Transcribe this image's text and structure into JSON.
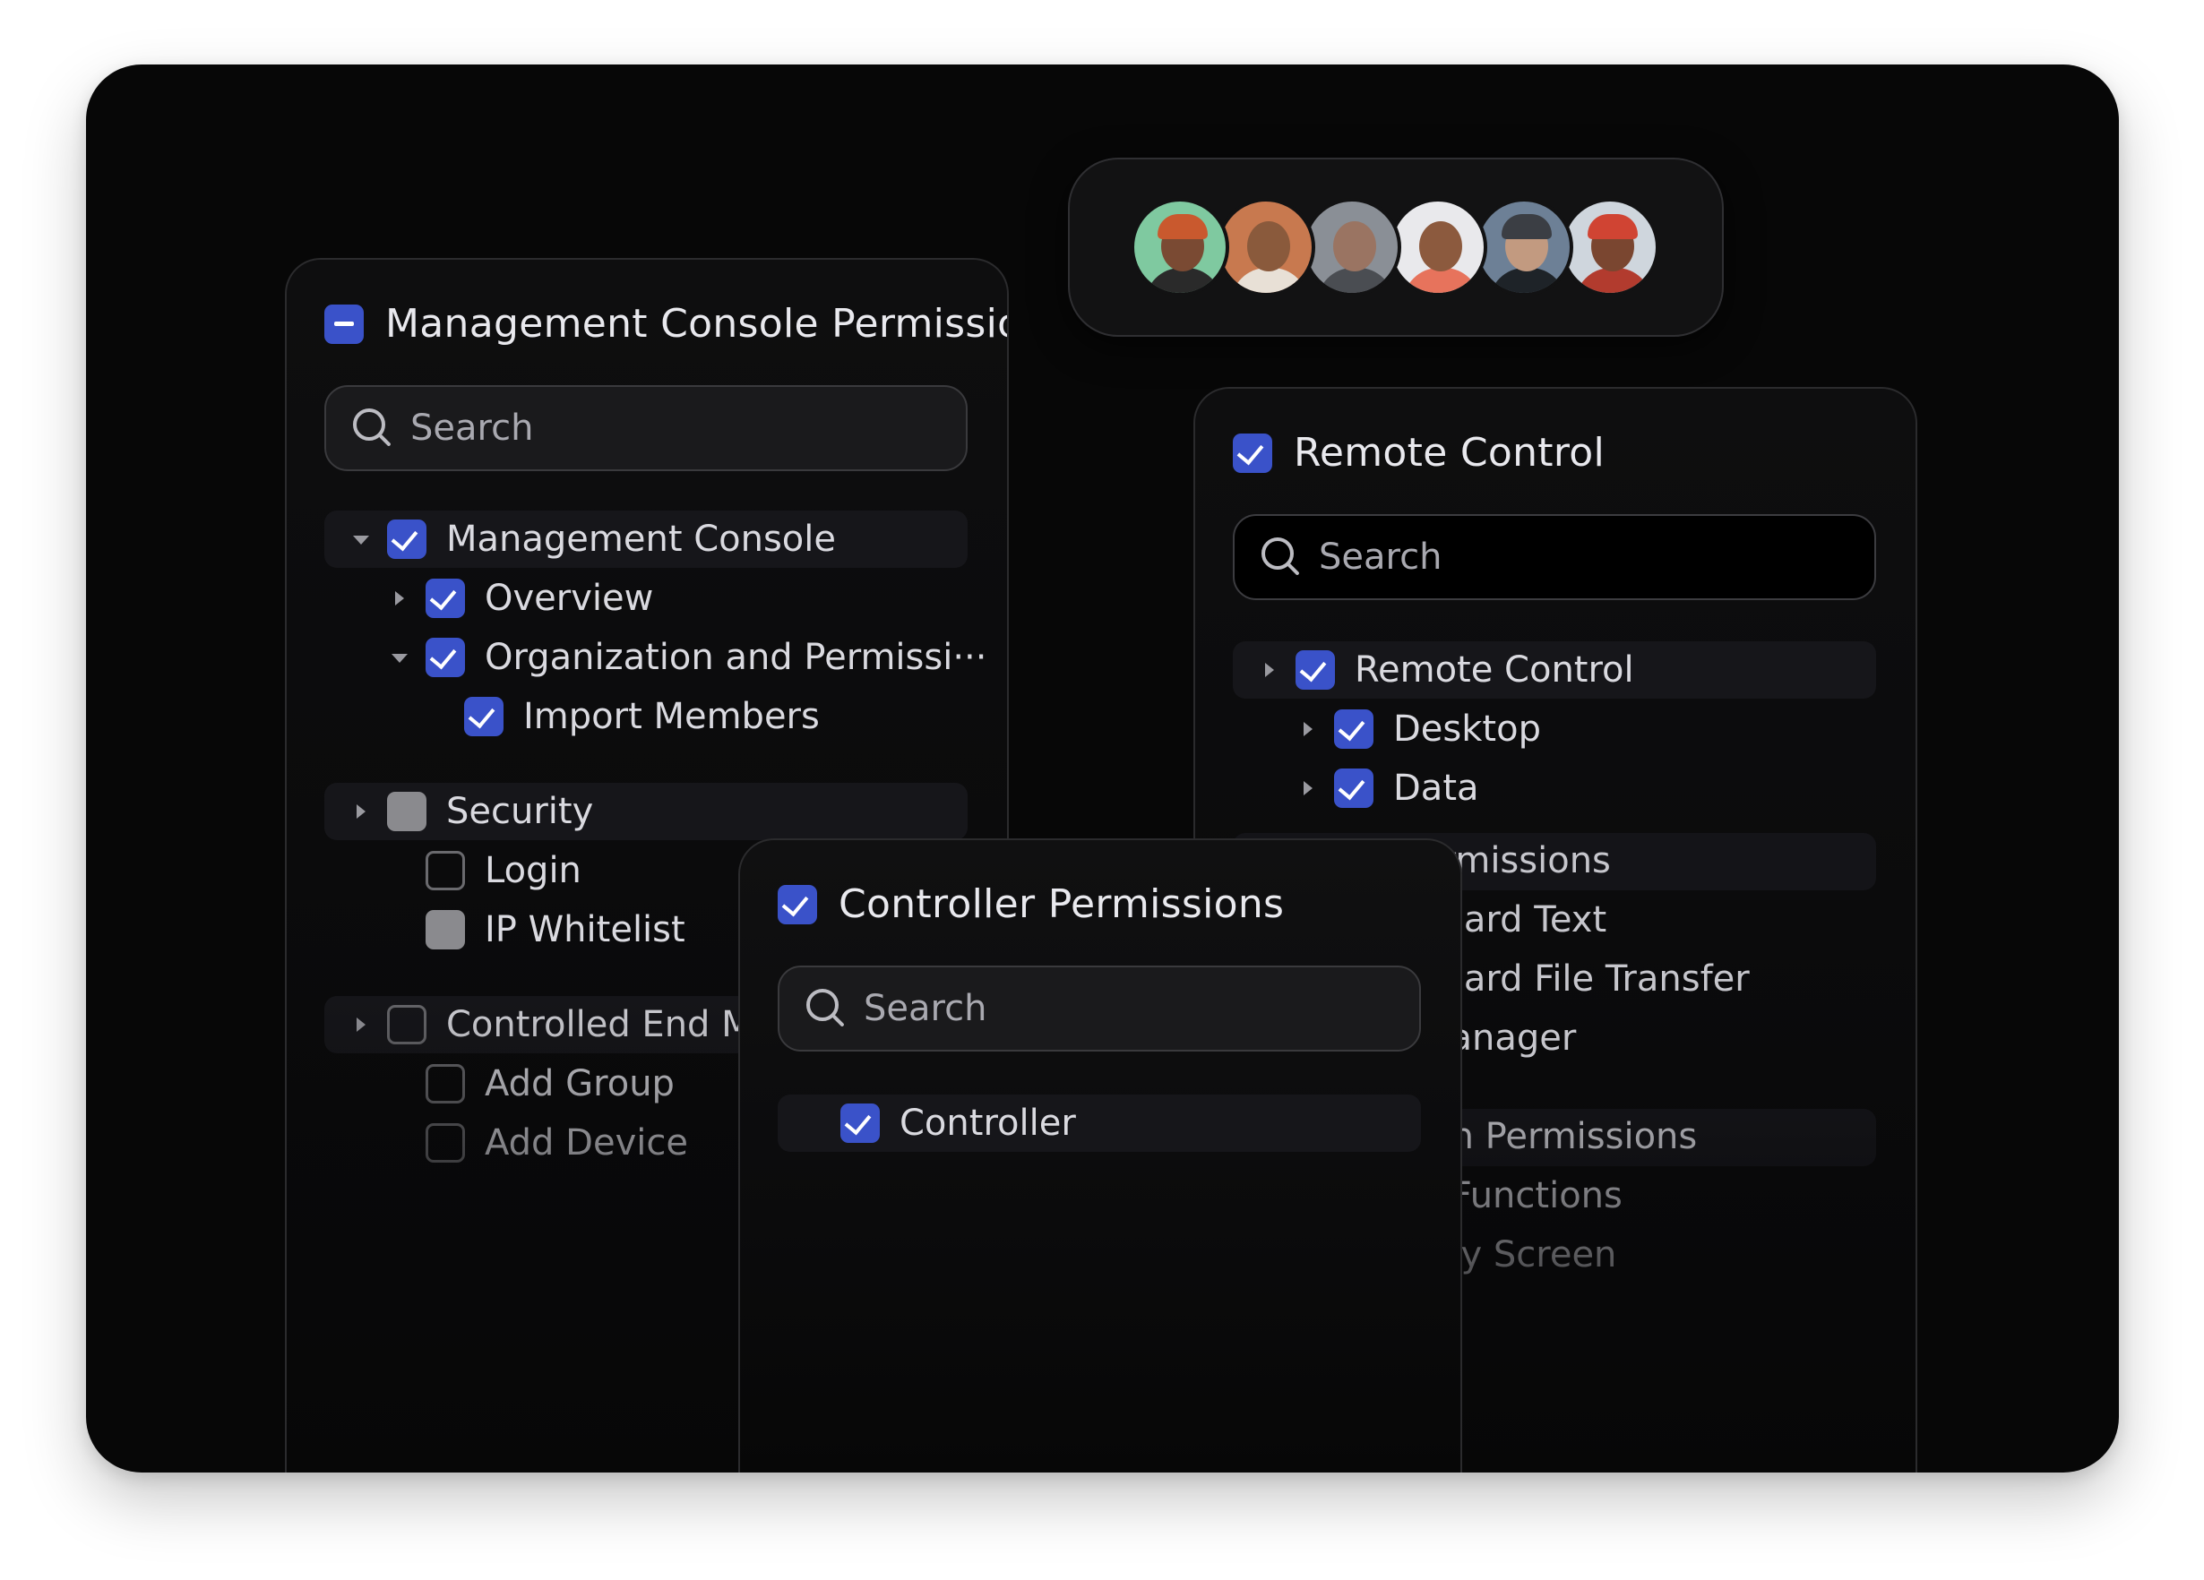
{
  "management_panel": {
    "title": "Management Console Permissions",
    "title_state": "indeterminate",
    "search_placeholder": "Search",
    "tree": [
      {
        "label": "Management Console",
        "state": "checked",
        "level": 0,
        "toggle": "down",
        "highlight": true
      },
      {
        "label": "Overview",
        "state": "checked",
        "level": 1,
        "toggle": "right"
      },
      {
        "label": "Organization and Permissi···",
        "state": "checked",
        "level": 1,
        "toggle": "down"
      },
      {
        "label": "Import Members",
        "state": "checked",
        "level": 2,
        "toggle": "none"
      },
      {
        "label": "Security",
        "state": "partial",
        "level": 0,
        "toggle": "right",
        "highlight": true
      },
      {
        "label": "Login",
        "state": "unchecked",
        "level": 1,
        "toggle": "none"
      },
      {
        "label": "IP Whitelist",
        "state": "partial",
        "level": 1,
        "toggle": "none"
      },
      {
        "label": "Controlled End Ma",
        "state": "unchecked",
        "level": 0,
        "toggle": "right",
        "highlight": true
      },
      {
        "label": "Add Group",
        "state": "unchecked",
        "level": 1,
        "toggle": "none"
      },
      {
        "label": "Add Device",
        "state": "unchecked",
        "level": 1,
        "toggle": "none"
      }
    ]
  },
  "remote_panel": {
    "title": "Remote Control",
    "title_state": "checked",
    "search_placeholder": "Search",
    "tree": [
      {
        "label": "Remote Control",
        "state": "checked",
        "level": 0,
        "toggle": "right",
        "highlight": true
      },
      {
        "label": "Desktop",
        "state": "checked",
        "level": 1,
        "toggle": "right"
      },
      {
        "label": "Data",
        "state": "checked",
        "level": 1,
        "toggle": "right"
      }
    ],
    "partial_labels": [
      "ermissions",
      "board Text",
      "board File Transfer",
      "Manager",
      "ion Permissions",
      "k Functions",
      "acy Screen"
    ]
  },
  "controller_panel": {
    "title": "Controller Permissions",
    "title_state": "checked",
    "search_placeholder": "Search",
    "tree": [
      {
        "label": "Controller",
        "state": "checked",
        "level": 0,
        "toggle": "none",
        "highlight": true
      }
    ]
  },
  "avatars": [
    {
      "name": "avatar-1",
      "bg": "#7fc9a0",
      "skin": "#7a4a33",
      "cloth": "#2a2a2a",
      "hat": "#c9592e"
    },
    {
      "name": "avatar-2",
      "bg": "#c8794f",
      "skin": "#8a5a3c",
      "cloth": "#e8e0d6",
      "hat": ""
    },
    {
      "name": "avatar-3",
      "bg": "#8a8f96",
      "skin": "#9a7462",
      "cloth": "#4a4d52",
      "hat": ""
    },
    {
      "name": "avatar-4",
      "bg": "#e9e9ec",
      "skin": "#8c5a3e",
      "cloth": "#e7735c",
      "hat": ""
    },
    {
      "name": "avatar-5",
      "bg": "#6d8096",
      "skin": "#c29a80",
      "cloth": "#1e2328",
      "hat": "#3b3e44"
    },
    {
      "name": "avatar-6",
      "bg": "#cfd6dd",
      "skin": "#7a4630",
      "cloth": "#b23b2e",
      "hat": "#d04433"
    }
  ],
  "colors": {
    "accent": "#3a52c9",
    "background": "#070707",
    "text": "#dadae0"
  }
}
